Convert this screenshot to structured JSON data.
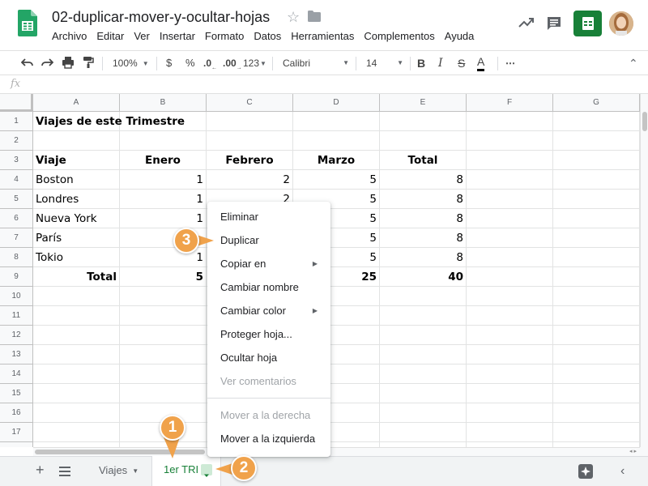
{
  "document": {
    "title": "02-duplicar-mover-y-ocultar-hojas"
  },
  "menu_bar": [
    "Archivo",
    "Editar",
    "Ver",
    "Insertar",
    "Formato",
    "Datos",
    "Herramientas",
    "Complementos",
    "Ayuda"
  ],
  "toolbar": {
    "zoom": "100%",
    "currency": "$",
    "percent": "%",
    "decrease_decimals": ".0",
    "increase_decimals": ".00",
    "more_formats": "123",
    "font": "Calibri",
    "font_size": "14",
    "bold": "B",
    "italic": "I",
    "strike": "S",
    "text_color": "A",
    "more": "⋯"
  },
  "formula_bar": {
    "fx_label": "fx"
  },
  "columns": [
    "A",
    "B",
    "C",
    "D",
    "E",
    "F",
    "G"
  ],
  "rows": [
    {
      "n": "1",
      "A": "Viajes de este Trimestre",
      "B": "",
      "C": "",
      "D": "",
      "E": ""
    },
    {
      "n": "2",
      "A": "",
      "B": "",
      "C": "",
      "D": "",
      "E": ""
    },
    {
      "n": "3",
      "A": "Viaje",
      "B": "Enero",
      "C": "Febrero",
      "D": "Marzo",
      "E": "Total"
    },
    {
      "n": "4",
      "A": "Boston",
      "B": "1",
      "C": "2",
      "D": "5",
      "E": "8"
    },
    {
      "n": "5",
      "A": "Londres",
      "B": "1",
      "C": "2",
      "D": "5",
      "E": "8"
    },
    {
      "n": "6",
      "A": "Nueva York",
      "B": "1",
      "C": "",
      "D": "5",
      "E": "8"
    },
    {
      "n": "7",
      "A": "París",
      "B": "",
      "C": "",
      "D": "5",
      "E": "8"
    },
    {
      "n": "8",
      "A": "Tokio",
      "B": "1",
      "C": "",
      "D": "5",
      "E": "8"
    },
    {
      "n": "9",
      "A": "Total",
      "B": "5",
      "C": "",
      "D": "25",
      "E": "40"
    },
    {
      "n": "10"
    },
    {
      "n": "11"
    },
    {
      "n": "12"
    },
    {
      "n": "13"
    },
    {
      "n": "14"
    },
    {
      "n": "15"
    },
    {
      "n": "16"
    },
    {
      "n": "17"
    },
    {
      "n": "18"
    }
  ],
  "context_menu": {
    "items": [
      {
        "label": "Eliminar",
        "disabled": false,
        "submenu": false
      },
      {
        "label": "Duplicar",
        "disabled": false,
        "submenu": false
      },
      {
        "label": "Copiar en",
        "disabled": false,
        "submenu": true
      },
      {
        "label": "Cambiar nombre",
        "disabled": false,
        "submenu": false
      },
      {
        "label": "Cambiar color",
        "disabled": false,
        "submenu": true
      },
      {
        "label": "Proteger hoja...",
        "disabled": false,
        "submenu": false
      },
      {
        "label": "Ocultar hoja",
        "disabled": false,
        "submenu": false
      },
      {
        "label": "Ver comentarios",
        "disabled": true,
        "submenu": false
      },
      {
        "label": "Mover a la derecha",
        "disabled": true,
        "submenu": false
      },
      {
        "label": "Mover a la izquierda",
        "disabled": false,
        "submenu": false
      }
    ]
  },
  "sheet_tabs": {
    "add": "+",
    "tabs": [
      {
        "label": "Viajes",
        "active": false
      },
      {
        "label": "1er TRI",
        "active": true
      }
    ]
  },
  "callouts": [
    "1",
    "2",
    "3"
  ],
  "colors": {
    "sheets_green": "#188038",
    "callout_orange": "#f0a24b",
    "active_tab_dropdown": "#ceead6"
  }
}
